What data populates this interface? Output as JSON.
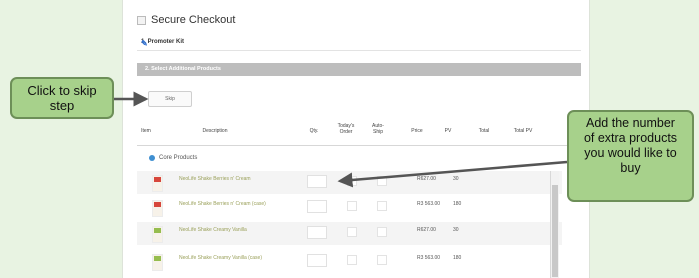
{
  "checkout": {
    "title": "Secure Checkout",
    "step1": "1. Promoter Kit",
    "step2": "2. Select Additional Products",
    "skip_label": "Skip"
  },
  "table": {
    "headers": {
      "item": "Item",
      "description": "Description",
      "qty": "Qty.",
      "today": "Today's\nOrder",
      "autoship": "Auto-\nShip",
      "price": "Price",
      "pv": "PV",
      "total": "Total",
      "totalpv": "Total PV"
    },
    "category": "Core Products",
    "rows": [
      {
        "desc": "NeoLife Shake Berries n' Cream",
        "price": "R627.00",
        "pv": "30"
      },
      {
        "desc": "NeoLife Shake Berries n' Cream (case)",
        "price": "R3 563.00",
        "pv": "180"
      },
      {
        "desc": "NeoLife Shake Creamy Vanilla",
        "price": "R627.00",
        "pv": "30"
      },
      {
        "desc": "NeoLife Shake Creamy Vanilla (case)",
        "price": "R3 563.00",
        "pv": "180"
      }
    ]
  },
  "callouts": {
    "skip": "Click to skip\nstep",
    "add": "Add the number\nof extra products\nyou would like to\nbuy"
  },
  "colors": {
    "callout_fill": "#a7d18b",
    "callout_border": "#6d8f58",
    "background": "#e8f3e2",
    "header_bar": "#bdbdbd"
  }
}
